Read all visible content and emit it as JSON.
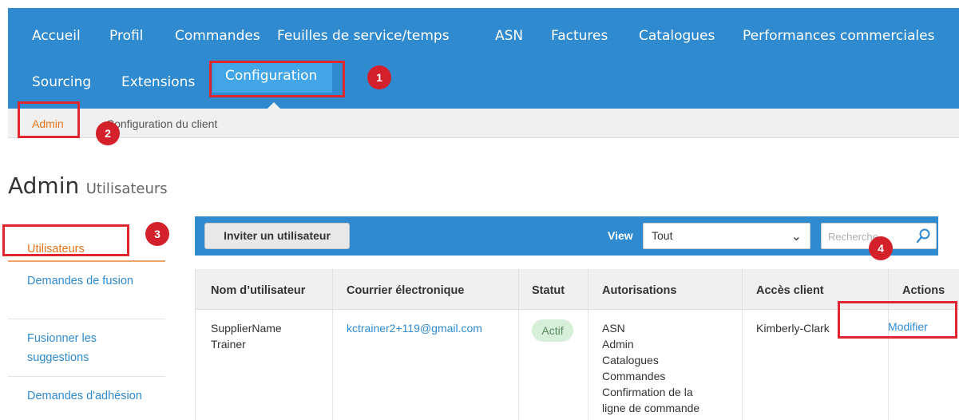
{
  "nav": {
    "row1": [
      "Accueil",
      "Profil",
      "Commandes",
      "Feuilles de service/temps",
      "ASN",
      "Factures",
      "Catalogues",
      "Performances commerciales"
    ],
    "row2": [
      "Sourcing",
      "Extensions"
    ],
    "active": "Configuration"
  },
  "subnav": {
    "admin": "Admin",
    "config": "Configuration du client"
  },
  "page": {
    "title": "Admin",
    "subtitle": "Utilisateurs"
  },
  "sidebar": {
    "items": [
      {
        "label": "Utilisateurs"
      },
      {
        "label": "Demandes de fusion"
      },
      {
        "label": "Fusionner les suggestions"
      },
      {
        "label": "Demandes d'adhésion"
      }
    ]
  },
  "toolbar": {
    "invite_label": "Inviter un utilisateur",
    "view_label": "View",
    "view_value": "Tout",
    "search_placeholder": "Recherche"
  },
  "table": {
    "headers": [
      "Nom d’utilisateur",
      "Courrier électronique",
      "Statut",
      "Autorisations",
      "Accès client",
      "Actions"
    ],
    "rows": [
      {
        "name_line1": "SupplierName",
        "name_line2": "Trainer",
        "email": "kctrainer2+119@gmail.com",
        "status": "Actif",
        "perm1": "ASN",
        "perm2": "Admin",
        "perm3": "Catalogues",
        "perm4": "Commandes",
        "perm5": "Confirmation de la",
        "perm6": "ligne de commande",
        "access": "Kimberly-Clark",
        "action": "Modifier"
      }
    ]
  },
  "annotations": [
    "1",
    "2",
    "3",
    "4"
  ],
  "colors": {
    "nav_blue": "#2f8ad0",
    "active_tab": "#42a5e5",
    "accent_orange": "#e8731a",
    "annotation_red": "#e0262f"
  }
}
